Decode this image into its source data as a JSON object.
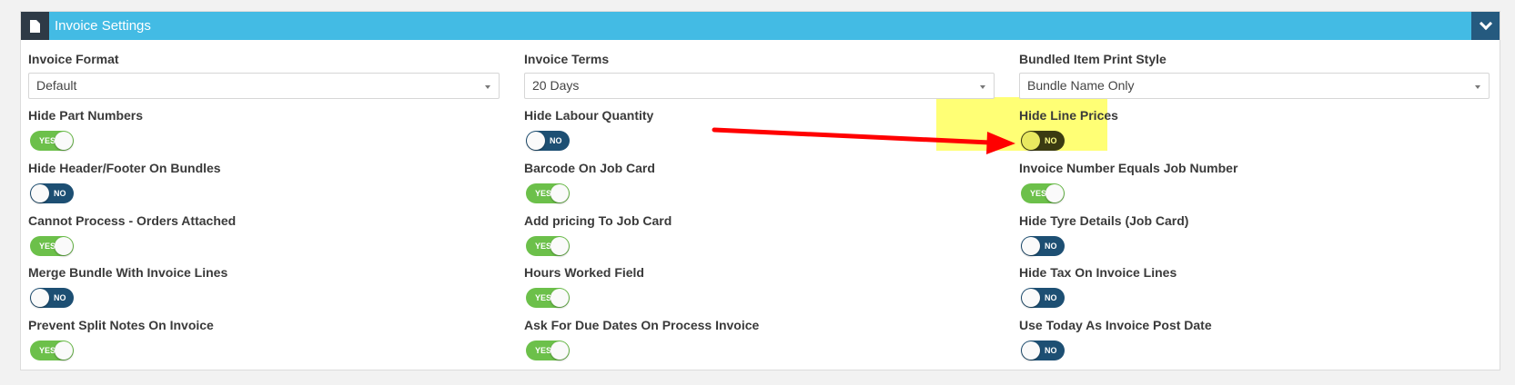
{
  "panel": {
    "title": "Invoice Settings",
    "doc_icon": "file-icon",
    "collapse_icon": "chevron-down-icon"
  },
  "selects": {
    "invoice_format": {
      "label": "Invoice Format",
      "value": "Default"
    },
    "invoice_terms": {
      "label": "Invoice Terms",
      "value": "20 Days"
    },
    "bundled_item_print_style": {
      "label": "Bundled Item Print Style",
      "value": "Bundle Name Only"
    }
  },
  "toggles": {
    "hide_part_numbers": {
      "label": "Hide Part Numbers",
      "state": "YES"
    },
    "hide_labour_quantity": {
      "label": "Hide Labour Quantity",
      "state": "NO"
    },
    "hide_line_prices": {
      "label": "Hide Line Prices",
      "state": "NO"
    },
    "hide_header_footer": {
      "label": "Hide Header/Footer On Bundles",
      "state": "NO"
    },
    "barcode_on_job_card": {
      "label": "Barcode On Job Card",
      "state": "YES"
    },
    "invoice_number_equals_job": {
      "label": "Invoice Number Equals Job Number",
      "state": "YES"
    },
    "cannot_process_orders": {
      "label": "Cannot Process - Orders Attached",
      "state": "YES"
    },
    "add_pricing_job_card": {
      "label": "Add pricing To Job Card",
      "state": "YES"
    },
    "hide_tyre_details": {
      "label": "Hide Tyre Details (Job Card)",
      "state": "NO"
    },
    "merge_bundle": {
      "label": "Merge Bundle With Invoice Lines",
      "state": "NO"
    },
    "hours_worked_field": {
      "label": "Hours Worked Field",
      "state": "YES"
    },
    "hide_tax_invoice_lines": {
      "label": "Hide Tax On Invoice Lines",
      "state": "NO"
    },
    "prevent_split_notes": {
      "label": "Prevent Split Notes On Invoice",
      "state": "YES"
    },
    "ask_due_dates": {
      "label": "Ask For Due Dates On Process Invoice",
      "state": "YES"
    },
    "use_today_post_date": {
      "label": "Use Today As Invoice Post Date",
      "state": "NO"
    }
  },
  "colors": {
    "header": "#43bbe4",
    "header_dark": "#2e3a46",
    "collapse": "#255a7f",
    "toggle_yes": "#6cc04a",
    "toggle_no": "#1d4f73",
    "highlight": "#ffff66",
    "arrow": "#ff0000"
  }
}
